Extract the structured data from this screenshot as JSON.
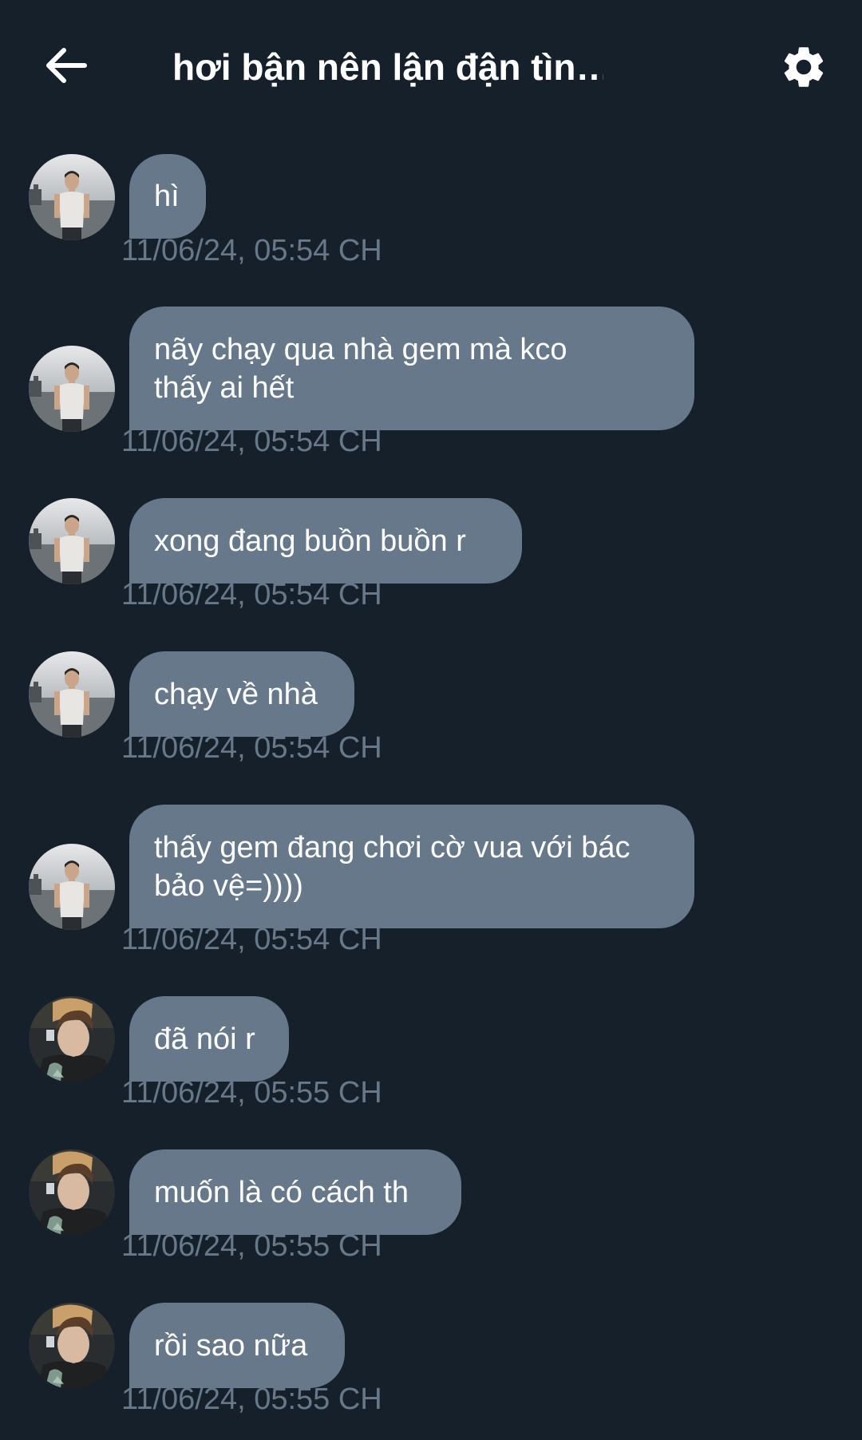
{
  "header": {
    "title": "hơi bận nên lận đận tìn…"
  },
  "colors": {
    "background": "#16202a",
    "bubble": "#66788a",
    "timestamp": "#66788a",
    "text": "#ffffff"
  },
  "messages": [
    {
      "text": "hì",
      "time": "11/06/24, 05:54 CH",
      "avatar": "avatar-a-icon"
    },
    {
      "text": "nãy chạy qua nhà gem mà kco\nthấy ai hết",
      "time": "11/06/24, 05:54 CH",
      "avatar": "avatar-a-icon"
    },
    {
      "text": "xong đang buồn buồn r",
      "time": "11/06/24, 05:54 CH",
      "avatar": "avatar-a-icon"
    },
    {
      "text": "chạy về nhà",
      "time": "11/06/24, 05:54 CH",
      "avatar": "avatar-a-icon"
    },
    {
      "text": "thấy gem đang chơi cờ vua với bác\nbảo vệ=))))",
      "time": "11/06/24, 05:54 CH",
      "avatar": "avatar-a-icon"
    },
    {
      "text": "đã nói r",
      "time": "11/06/24, 05:55 CH",
      "avatar": "avatar-b-icon"
    },
    {
      "text": "muốn là có cách th",
      "time": "11/06/24, 05:55 CH",
      "avatar": "avatar-b-icon"
    },
    {
      "text": "rồi sao nữa",
      "time": "11/06/24, 05:55 CH",
      "avatar": "avatar-b-icon"
    }
  ]
}
